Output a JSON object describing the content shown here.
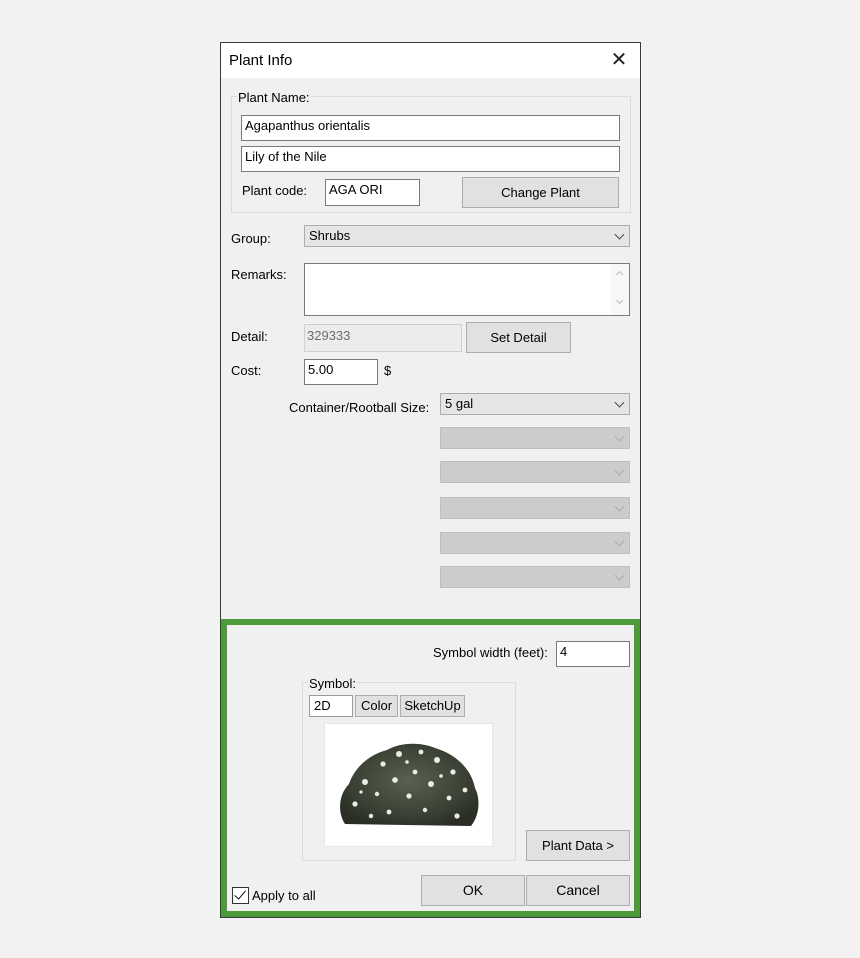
{
  "window": {
    "title": "Plant Info"
  },
  "plant_name": {
    "group_label": "Plant Name:",
    "botanical": "Agapanthus orientalis",
    "common": "Lily of the Nile",
    "code_label": "Plant code:",
    "code": "AGA ORI",
    "change_button": "Change Plant"
  },
  "group": {
    "label": "Group:",
    "value": "Shrubs"
  },
  "remarks": {
    "label": "Remarks:",
    "value": ""
  },
  "detail": {
    "label": "Detail:",
    "value": "329333",
    "button": "Set Detail"
  },
  "cost": {
    "label": "Cost:",
    "value": "5.00",
    "unit": "$"
  },
  "container": {
    "label": "Container/Rootball Size:",
    "value": "5 gal"
  },
  "symbol_width": {
    "label": "Symbol width (feet):",
    "value": "4"
  },
  "symbol": {
    "group_label": "Symbol:",
    "tabs": [
      "2D",
      "Color",
      "SketchUp"
    ],
    "active_tab": "2D"
  },
  "plant_data_button": "Plant Data >",
  "apply_all": {
    "label": "Apply to all",
    "checked": true
  },
  "ok_button": "OK",
  "cancel_button": "Cancel",
  "colors": {
    "accent_frame": "#4e9a3a",
    "disabled_combo": "#cccccc"
  },
  "icons": {
    "close": "close-icon",
    "chevron": "chevron-down-icon",
    "check": "checkmark-icon"
  }
}
